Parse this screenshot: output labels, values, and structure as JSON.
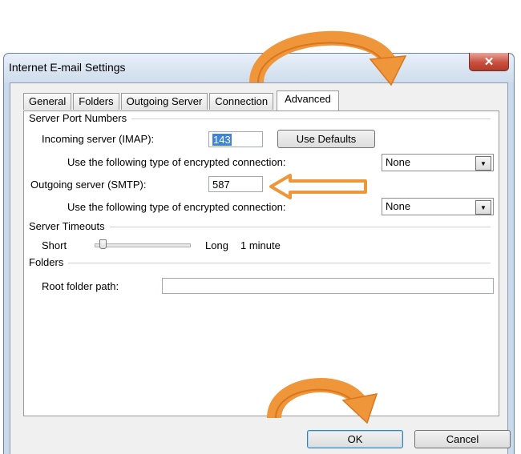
{
  "window": {
    "title": "Internet E-mail Settings",
    "close_glyph": "✕"
  },
  "tabs": [
    {
      "label": "General"
    },
    {
      "label": "Folders"
    },
    {
      "label": "Outgoing Server"
    },
    {
      "label": "Connection"
    },
    {
      "label": "Advanced",
      "active": true
    }
  ],
  "server_ports": {
    "group_label": "Server Port Numbers",
    "incoming_label": "Incoming server (IMAP):",
    "incoming_value": "143",
    "use_defaults_label": "Use Defaults",
    "incoming_enc_label": "Use the following type of encrypted connection:",
    "incoming_enc_value": "None",
    "outgoing_label": "Outgoing server (SMTP):",
    "outgoing_value": "587",
    "outgoing_enc_label": "Use the following type of encrypted connection:",
    "outgoing_enc_value": "None"
  },
  "timeouts": {
    "group_label": "Server Timeouts",
    "short_label": "Short",
    "long_label": "Long",
    "value_label": "1 minute"
  },
  "folders": {
    "group_label": "Folders",
    "root_label": "Root folder path:",
    "root_value": ""
  },
  "footer": {
    "ok_label": "OK",
    "cancel_label": "Cancel"
  },
  "icons": {
    "dropdown": "chevron-down-icon",
    "close": "close-icon"
  },
  "colors": {
    "callout_arrow": "#f0963a",
    "selection": "#3f84d8"
  }
}
